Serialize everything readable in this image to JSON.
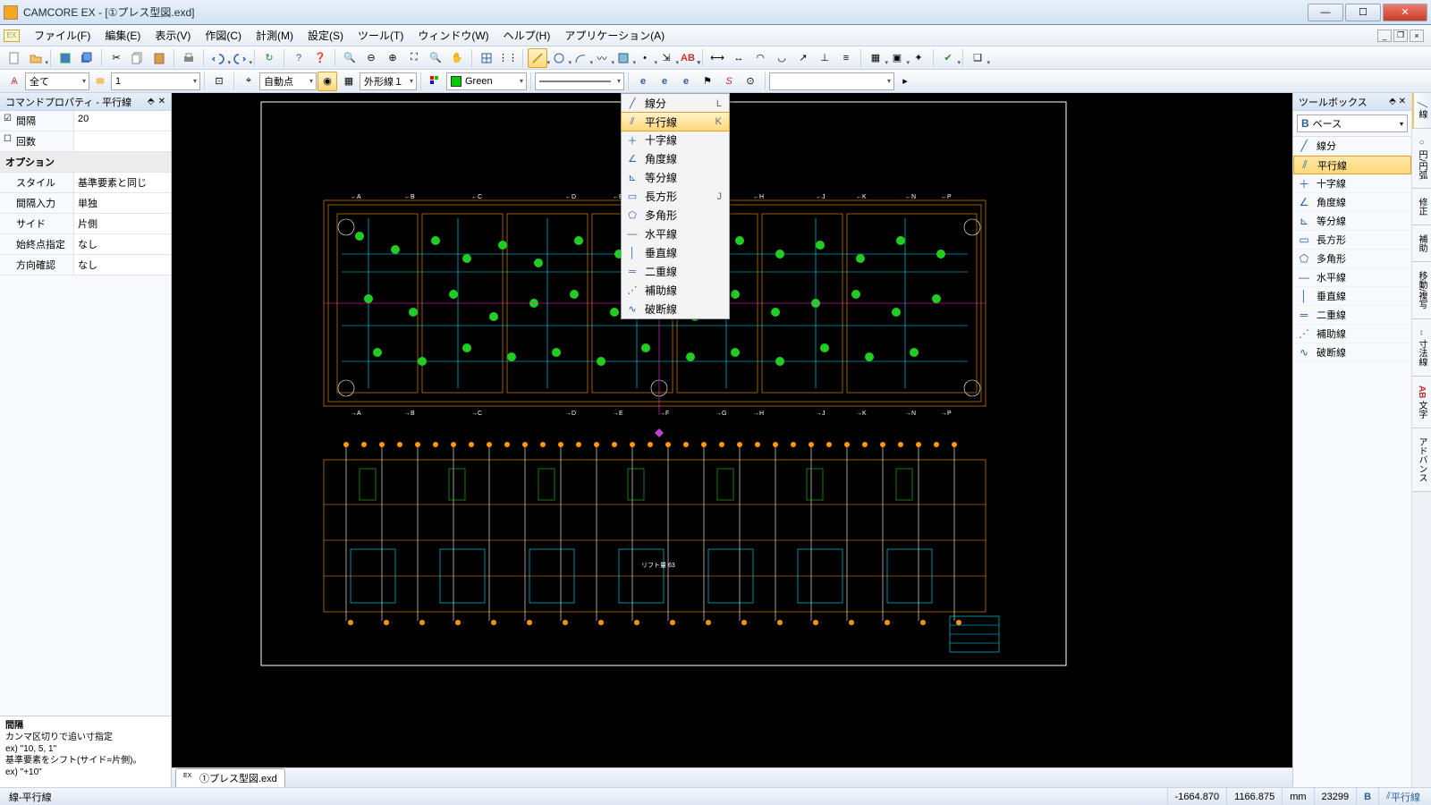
{
  "title": "CAMCORE EX - [①プレス型図.exd]",
  "menus": [
    "ファイル(F)",
    "編集(E)",
    "表示(V)",
    "作図(C)",
    "計測(M)",
    "設定(S)",
    "ツール(T)",
    "ウィンドウ(W)",
    "ヘルプ(H)",
    "アプリケーション(A)"
  ],
  "tb2": {
    "all": "全て",
    "layer": "1",
    "snap": "自動点",
    "outline": "外形線１",
    "color": "Green"
  },
  "cmd_panel": {
    "title": "コマンドプロパティ - 平行線",
    "rows": [
      {
        "k": "間隔",
        "v": "20",
        "chk": true
      },
      {
        "k": "回数",
        "v": "",
        "chk": false
      }
    ],
    "cat": "オプション",
    "opts": [
      {
        "k": "スタイル",
        "v": "基準要素と同じ"
      },
      {
        "k": "間隔入力",
        "v": "単独"
      },
      {
        "k": "サイド",
        "v": "片側"
      },
      {
        "k": "始終点指定",
        "v": "なし"
      },
      {
        "k": "方向確認",
        "v": "なし"
      }
    ],
    "hint_title": "間隔",
    "hint_lines": [
      "カンマ区切りで追い寸指定",
      " ex) \"10, 5, 1\"",
      "基準要素をシフト(サイド=片側)。",
      " ex) \"+10\""
    ]
  },
  "dropdown": [
    {
      "label": "線分",
      "key": "L",
      "icon": "╱"
    },
    {
      "label": "平行線",
      "key": "K",
      "icon": "⫽",
      "hl": true
    },
    {
      "label": "十字線",
      "key": "",
      "icon": "＋"
    },
    {
      "label": "角度線",
      "key": "",
      "icon": "∠"
    },
    {
      "label": "等分線",
      "key": "",
      "icon": "⊾"
    },
    {
      "label": "長方形",
      "key": "J",
      "icon": "▭"
    },
    {
      "label": "多角形",
      "key": "",
      "icon": "⬠"
    },
    {
      "label": "水平線",
      "key": "",
      "icon": "—"
    },
    {
      "label": "垂直線",
      "key": "",
      "icon": "│"
    },
    {
      "label": "二重線",
      "key": "",
      "icon": "═"
    },
    {
      "label": "補助線",
      "key": "",
      "icon": "⋰"
    },
    {
      "label": "破断線",
      "key": "",
      "icon": "∿"
    }
  ],
  "toolbox": {
    "title": "ツールボックス",
    "combo": "ベース",
    "items": [
      {
        "label": "線分",
        "icon": "╱"
      },
      {
        "label": "平行線",
        "icon": "⫽",
        "hl": true
      },
      {
        "label": "十字線",
        "icon": "＋"
      },
      {
        "label": "角度線",
        "icon": "∠"
      },
      {
        "label": "等分線",
        "icon": "⊾"
      },
      {
        "label": "長方形",
        "icon": "▭"
      },
      {
        "label": "多角形",
        "icon": "⬠"
      },
      {
        "label": "水平線",
        "icon": "—"
      },
      {
        "label": "垂直線",
        "icon": "│"
      },
      {
        "label": "二重線",
        "icon": "═"
      },
      {
        "label": "補助線",
        "icon": "⋰"
      },
      {
        "label": "破断線",
        "icon": "∿"
      }
    ],
    "tabs": [
      "線",
      "円/円弧",
      "修正",
      "補助",
      "移動/複写",
      "寸法線",
      "文字",
      "アドバンス"
    ]
  },
  "doc_tab": "①プレス型図.exd",
  "status": {
    "mode": "線-平行線",
    "x": "-1664.870",
    "y": "1166.875",
    "unit": "mm",
    "scale": "23299",
    "cmd": "平行線"
  }
}
